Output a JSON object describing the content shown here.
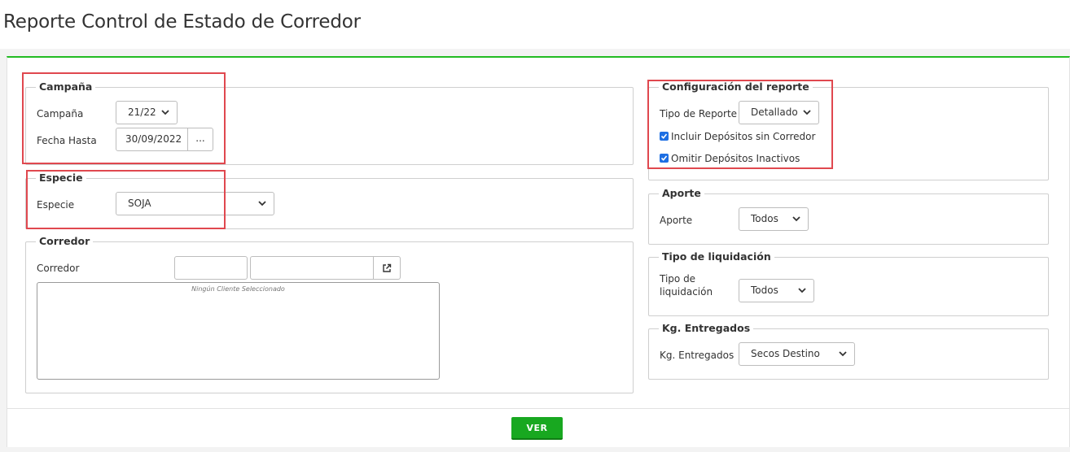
{
  "page": {
    "title": "Reporte Control de Estado de Corredor"
  },
  "campana_section": {
    "legend": "Campaña",
    "campana_label": "Campaña",
    "campana_value": "21/22",
    "fecha_label": "Fecha Hasta",
    "fecha_value": "30/09/2022",
    "fecha_button": "..."
  },
  "especie_section": {
    "legend": "Especie",
    "especie_label": "Especie",
    "especie_value": "SOJA"
  },
  "corredor_section": {
    "legend": "Corredor",
    "corredor_label": "Corredor",
    "code_value": "",
    "name_value": "",
    "empty_message": "Ningún Cliente Seleccionado"
  },
  "config_section": {
    "legend": "Configuración del reporte",
    "tipo_label": "Tipo de Reporte",
    "tipo_value": "Detallado",
    "incluir_label": "Incluir Depósitos sin Corredor",
    "incluir_checked": true,
    "omitir_label": "Omitir Depósitos Inactivos",
    "omitir_checked": true
  },
  "aporte_section": {
    "legend": "Aporte",
    "aporte_label": "Aporte",
    "aporte_value": "Todos"
  },
  "liquidacion_section": {
    "legend": "Tipo de liquidación",
    "label_line1": "Tipo de",
    "label_line2": "liquidación",
    "value": "Todos"
  },
  "kg_section": {
    "legend": "Kg. Entregados",
    "kg_label": "Kg. Entregados",
    "kg_value": "Secos Destino"
  },
  "footer": {
    "ver_button": "VER"
  },
  "colors": {
    "accent_green": "#22bb22",
    "button_green": "#18a820",
    "highlight_red": "#e0484f",
    "checkbox_blue": "#1e6fe3"
  }
}
